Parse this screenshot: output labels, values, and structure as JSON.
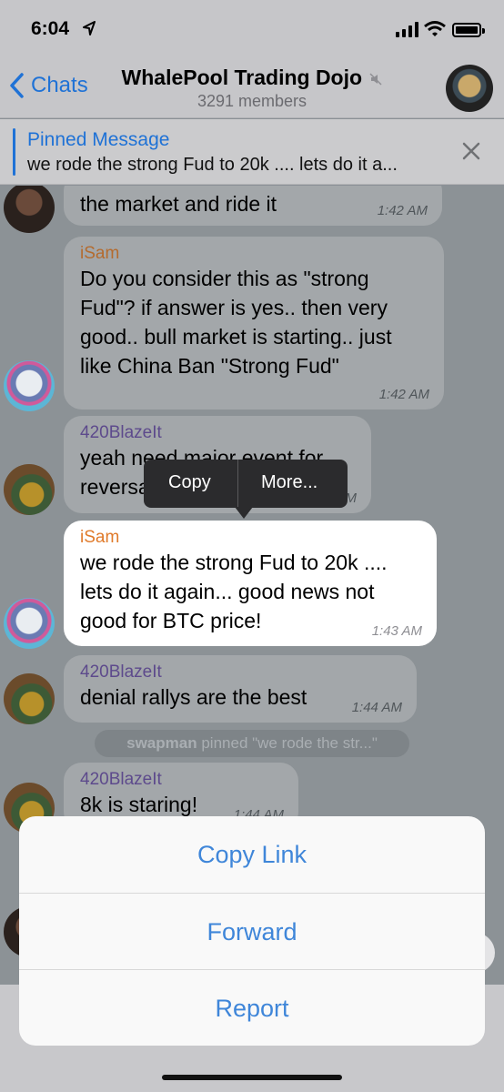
{
  "status_bar": {
    "time": "6:04"
  },
  "nav": {
    "back_label": "Chats",
    "title": "WhalePool Trading Dojo",
    "subtitle": "3291 members"
  },
  "pinned": {
    "title": "Pinned Message",
    "text": "we rode the strong Fud to 20k .... lets do it a..."
  },
  "messages": [
    {
      "sender": "",
      "lines": [
        "the market and ride it"
      ],
      "time": "1:42 AM"
    },
    {
      "sender": "iSam",
      "lines": [
        "Do you consider this as \"strong",
        "Fud\"? if answer is yes.. then very",
        "good.. bull market is starting.. just",
        "like China Ban \"Strong Fud\""
      ],
      "time": "1:42 AM"
    },
    {
      "sender": "420BlazeIt",
      "lines": [
        "yeah need major event for",
        "reversal"
      ],
      "time": "1:42 AM"
    },
    {
      "sender": "iSam",
      "lines": [
        "we rode the strong Fud to 20k ....",
        "lets do it again... good news not",
        "good for BTC price!"
      ],
      "time": "1:43 AM"
    },
    {
      "sender": "420BlazeIt",
      "lines": [
        "denial rallys are the best"
      ],
      "time": "1:44 AM"
    },
    {
      "sender": "420BlazeIt",
      "lines": [
        "8k is staring!"
      ],
      "time": "1:44 AM"
    }
  ],
  "service_message": {
    "actor": "swapman",
    "text": "pinned \"we rode the str...\""
  },
  "context_menu": {
    "copy": "Copy",
    "more": "More..."
  },
  "action_sheet": {
    "copy_link": "Copy Link",
    "forward": "Forward",
    "report": "Report"
  },
  "colors": {
    "accent": "#1f72d6",
    "sheet_text": "#3f86d9",
    "isam_name": "#e07a2a",
    "blaze_name": "#5d4a8c"
  }
}
